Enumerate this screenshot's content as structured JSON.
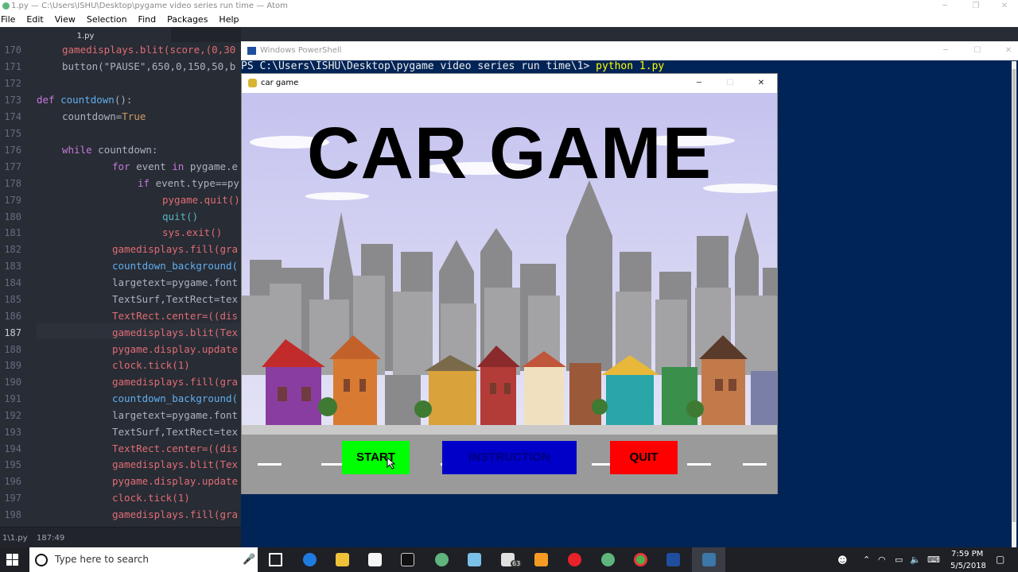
{
  "atom": {
    "title": "1.py — C:\\Users\\ISHU\\Desktop\\pygame video series run time — Atom",
    "menu": [
      "File",
      "Edit",
      "View",
      "Selection",
      "Find",
      "Packages",
      "Help"
    ],
    "tab_label": "1.py",
    "status_path": "1\\1.py",
    "status_pos": "187:49",
    "line_numbers": [
      "170",
      "171",
      "172",
      "173",
      "174",
      "175",
      "176",
      "177",
      "178",
      "179",
      "180",
      "181",
      "182",
      "183",
      "184",
      "185",
      "186",
      "187",
      "188",
      "189",
      "190",
      "191",
      "192",
      "193",
      "194",
      "195",
      "196",
      "197",
      "198"
    ],
    "code": {
      "l170": [
        "gamedisplays.blit(score,(0,30",
        ""
      ],
      "l171": [
        "button(\"PAUSE\",650,0,150,50,b",
        ""
      ],
      "l173_def": "def",
      "l173_name": " countdown",
      "l173_rest": "():",
      "l174_a": "countdown=",
      "l174_b": "True",
      "l176_a": "while",
      "l176_b": " countdown:",
      "l177_a": "for",
      "l177_b": " event ",
      "l177_c": "in",
      "l177_d": " pygame.e",
      "l178_a": "if",
      "l178_b": " event.type==py",
      "l179": "pygame.quit()",
      "l180": "quit()",
      "l181": "sys.exit()",
      "l182": "gamedisplays.fill(gra",
      "l183": "countdown_background(",
      "l184": "largetext=pygame.font",
      "l185": "TextSurf,TextRect=tex",
      "l186": "TextRect.center=((dis",
      "l187": "gamedisplays.blit(Tex",
      "l188": "pygame.display.update",
      "l189": "clock.tick(1)",
      "l190": "gamedisplays.fill(gra",
      "l191": "countdown_background(",
      "l192": "largetext=pygame.font",
      "l193": "TextSurf,TextRect=tex",
      "l194": "TextRect.center=((dis",
      "l195": "gamedisplays.blit(Tex",
      "l196": "pygame.display.update",
      "l197": "clock.tick(1)",
      "l198": "gamedisplays.fill(gra"
    }
  },
  "powershell": {
    "title": "Windows PowerShell",
    "prompt": "PS C:\\Users\\ISHU\\Desktop\\pygame video series run time\\1> ",
    "command": "python 1.py"
  },
  "game": {
    "window_title": "car game",
    "heading": "CAR GAME",
    "buttons": {
      "start": "START",
      "instruction": "INSTRUCTION",
      "quit": "QUIT"
    },
    "colors": {
      "start": "#00ff00",
      "instruction": "#0000c8",
      "quit": "#ff0000",
      "sky": "#c9c8ee"
    }
  },
  "taskbar": {
    "search_placeholder": "Type here to search",
    "mail_badge": "63",
    "time": "7:59 PM",
    "date": "5/5/2018"
  }
}
